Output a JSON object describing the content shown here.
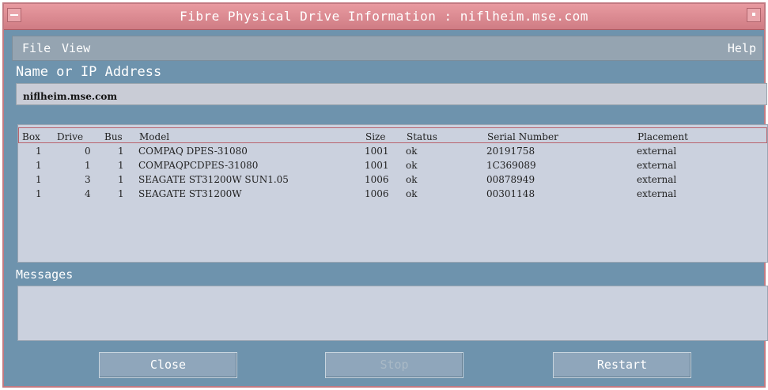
{
  "window": {
    "title": "Fibre Physical Drive Information : niflheim.mse.com"
  },
  "menu": {
    "file": "File",
    "view": "View",
    "help": "Help"
  },
  "address": {
    "label": "Name or IP Address",
    "value": "niflheim.mse.com"
  },
  "table": {
    "headers": {
      "box": "Box",
      "drive": "Drive",
      "bus": "Bus",
      "model": "Model",
      "size": "Size",
      "status": "Status",
      "serial": "Serial Number",
      "placement": "Placement"
    },
    "rows": [
      {
        "box": "1",
        "drive": "0",
        "bus": "1",
        "model": "COMPAQ  DPES-31080",
        "size": "1001",
        "status": "ok",
        "serial": "20191758",
        "placement": "external"
      },
      {
        "box": "1",
        "drive": "1",
        "bus": "1",
        "model": "COMPAQPCDPES-31080",
        "size": "1001",
        "status": "ok",
        "serial": "1C369089",
        "placement": "external"
      },
      {
        "box": "1",
        "drive": "3",
        "bus": "1",
        "model": "SEAGATE ST31200W SUN1.05",
        "size": "1006",
        "status": "ok",
        "serial": "00878949",
        "placement": "external"
      },
      {
        "box": "1",
        "drive": "4",
        "bus": "1",
        "model": "SEAGATE ST31200W",
        "size": "1006",
        "status": "ok",
        "serial": "00301148",
        "placement": "external"
      }
    ]
  },
  "messages": {
    "label": "Messages",
    "content": ""
  },
  "buttons": {
    "close": "Close",
    "stop": "Stop",
    "restart": "Restart"
  }
}
